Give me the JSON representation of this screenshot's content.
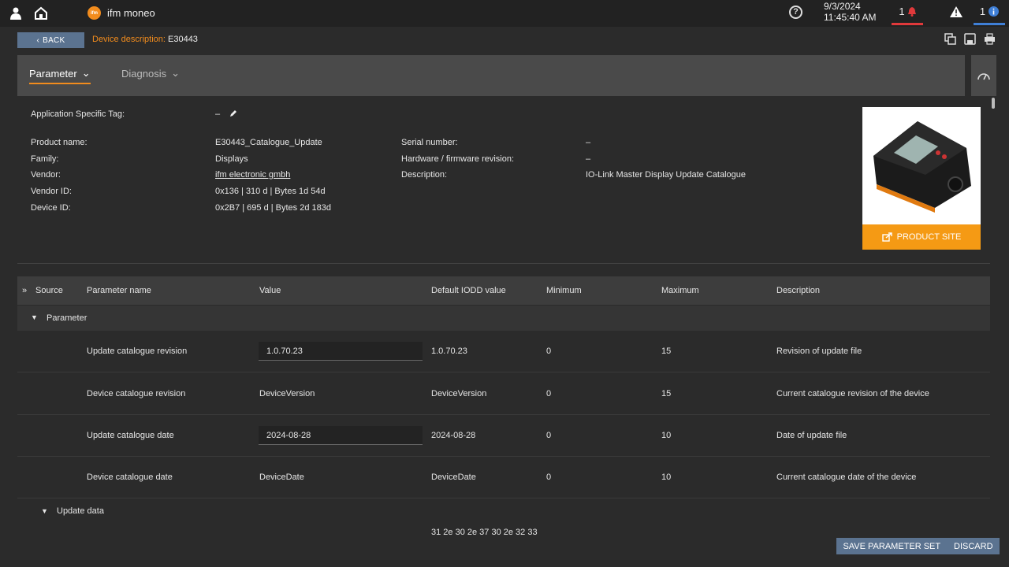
{
  "topbar": {
    "app_name": "ifm moneo",
    "logo_text": "ifm",
    "date": "9/3/2024",
    "time": "11:45:40 AM",
    "alarm_count": "1",
    "info_count": "1",
    "help_glyph": "?"
  },
  "breadcrumb": {
    "back_label": "BACK",
    "label": "Device description:",
    "value": "E30443"
  },
  "tabs": [
    {
      "label": "Parameter",
      "active": true
    },
    {
      "label": "Diagnosis",
      "active": false
    }
  ],
  "device": {
    "app_tag_label": "Application Specific Tag:",
    "app_tag_value": "–",
    "fields_left": [
      {
        "label": "Product name:",
        "value": "E30443_Catalogue_Update"
      },
      {
        "label": "Family:",
        "value": "Displays"
      },
      {
        "label": "Vendor:",
        "value": "ifm electronic gmbh"
      },
      {
        "label": "Vendor ID:",
        "value": "0x136 | 310 d | Bytes 1d 54d"
      },
      {
        "label": "Device ID:",
        "value": "0x2B7 | 695 d | Bytes 2d 183d"
      }
    ],
    "fields_right": [
      {
        "label": "Serial number:",
        "value": "–"
      },
      {
        "label": "Hardware / firmware revision:",
        "value": "–"
      },
      {
        "label": "Description:",
        "value": "IO-Link Master Display Update Catalogue"
      }
    ],
    "product_site_label": "PRODUCT SITE"
  },
  "table": {
    "headers": [
      "Source",
      "Parameter name",
      "Value",
      "Default IODD value",
      "Minimum",
      "Maximum",
      "Description"
    ],
    "group_label": "Parameter",
    "rows": [
      {
        "name": "Update catalogue revision",
        "value": "1.0.70.23",
        "editable": true,
        "default": "1.0.70.23",
        "min": "0",
        "max": "15",
        "desc": "Revision of update file"
      },
      {
        "name": "Device catalogue revision",
        "value": "DeviceVersion",
        "editable": false,
        "default": "DeviceVersion",
        "min": "0",
        "max": "15",
        "desc": "Current catalogue revision of the device"
      },
      {
        "name": "Update catalogue date",
        "value": "2024-08-28",
        "editable": true,
        "default": "2024-08-28",
        "min": "0",
        "max": "10",
        "desc": "Date of update file"
      },
      {
        "name": "Device catalogue date",
        "value": "DeviceDate",
        "editable": false,
        "default": "DeviceDate",
        "min": "0",
        "max": "10",
        "desc": "Current catalogue date of the device"
      }
    ],
    "subgroup_label": "Update data",
    "partial_value": "31 2e 30 2e 37 30 2e 32 33"
  },
  "footer": {
    "save_label": "SAVE PARAMETER SET",
    "discard_label": "DISCARD"
  },
  "colors": {
    "accent": "#f28c1d",
    "button": "#5b7390",
    "alarm": "#e0393b",
    "info": "#3f7fd6"
  }
}
